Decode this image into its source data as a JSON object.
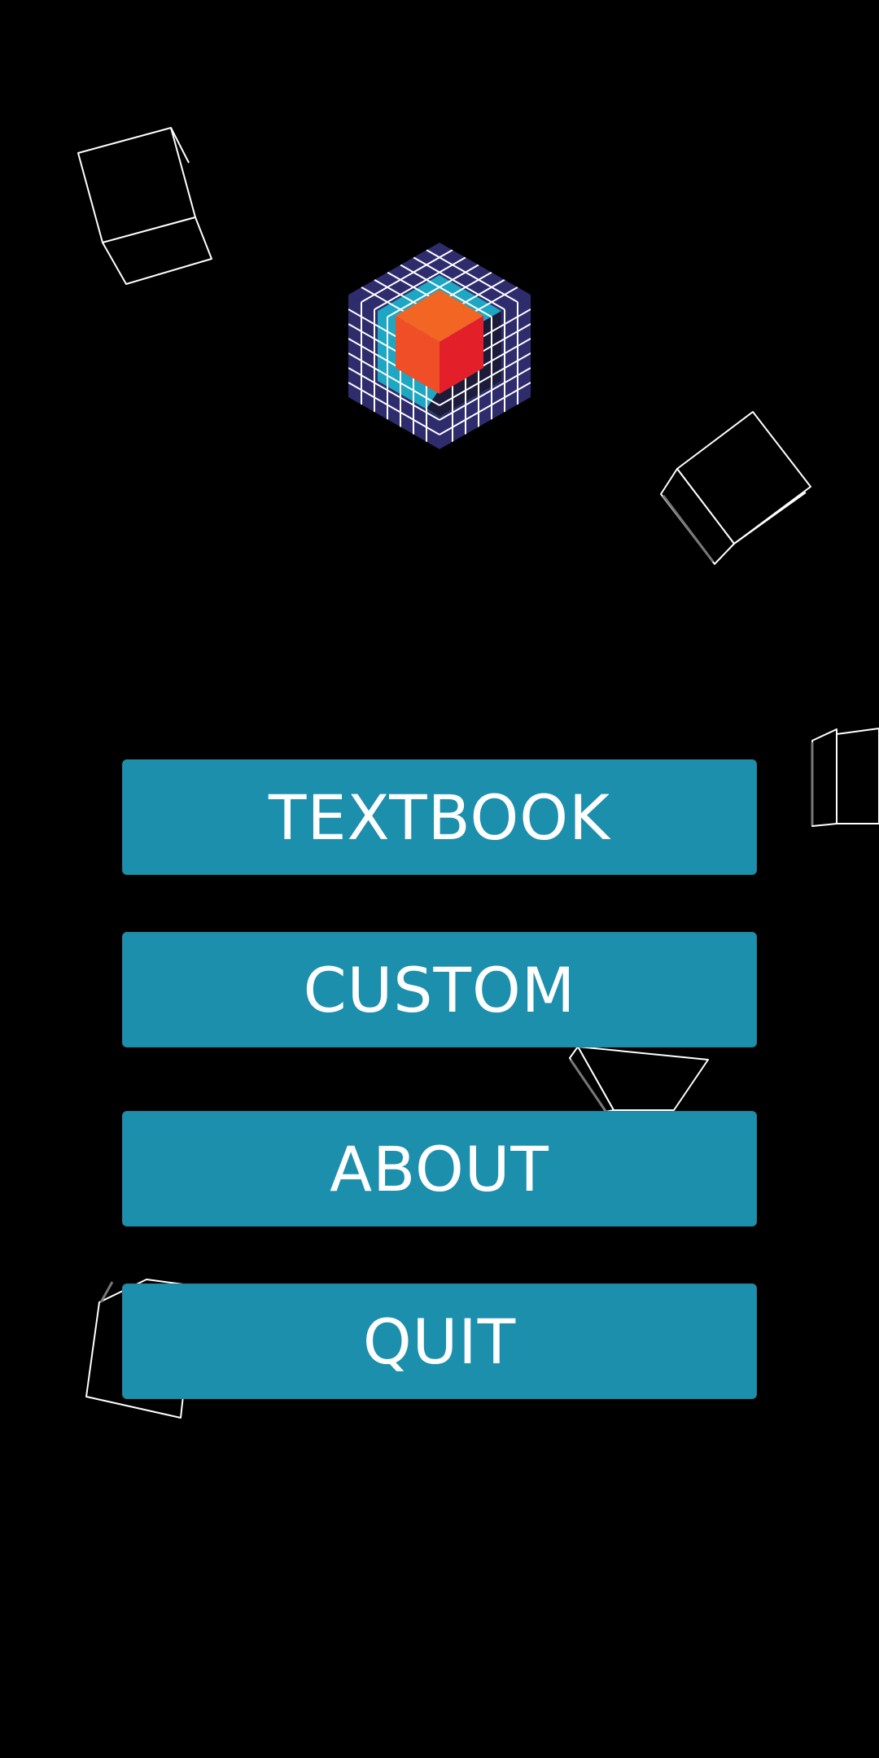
{
  "theme": {
    "background": "#000000",
    "button_color": "#1c8fad",
    "button_text_color": "#ffffff",
    "logo_colors": {
      "outer_grid": "#2f2c6e",
      "inner_grid": "#1ea7c2",
      "shadow": "#1c1c3a",
      "grid_lines": "#ffffff",
      "cube_top": "#f26522",
      "cube_left": "#f04e26",
      "cube_right": "#e3202a"
    }
  },
  "logo": {
    "icon": "rubiks-cube-logo-icon"
  },
  "menu": {
    "buttons": [
      {
        "id": "textbook",
        "label": "TEXTBOOK"
      },
      {
        "id": "custom",
        "label": "CUSTOM"
      },
      {
        "id": "about",
        "label": "ABOUT"
      },
      {
        "id": "quit",
        "label": "QUIT"
      }
    ]
  },
  "background": {
    "decoration": "floating-wireframe-cubes"
  }
}
